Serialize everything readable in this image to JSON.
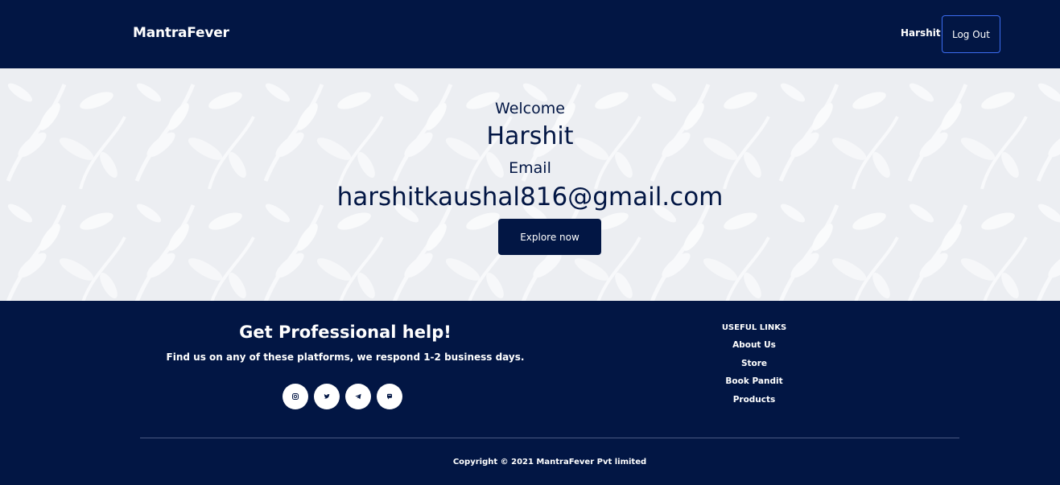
{
  "header": {
    "brand": "MantraFever",
    "user_name": "Harshit",
    "logout_label": "Log Out"
  },
  "hero": {
    "welcome": "Welcome",
    "name": "Harshit",
    "email_label": "Email",
    "email_value": "harshitkaushal816@gmail.com",
    "explore_label": "Explore now"
  },
  "footer": {
    "help_title": "Get Professional help!",
    "help_subtitle": "Find us on any of these platforms, we respond 1-2 business days.",
    "socials": [
      "instagram-icon",
      "twitter-icon",
      "telegram-icon",
      "chat-icon"
    ],
    "links_heading": "USEFUL LINKS",
    "links": [
      "About Us",
      "Store",
      "Book Pandit",
      "Products"
    ],
    "copyright": "Copyright © 2021 MantraFever Pvt limited"
  },
  "colors": {
    "navy": "#021644",
    "hero_bg": "#eceef2",
    "logout_border": "#3b6cf0"
  }
}
